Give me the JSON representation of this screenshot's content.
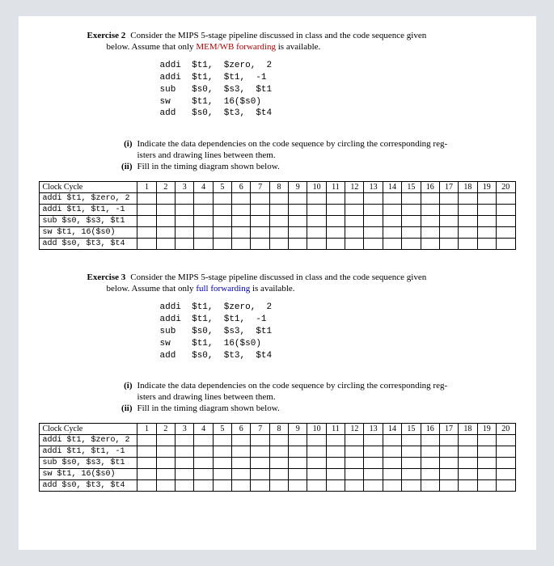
{
  "exercises": [
    {
      "label": "Exercise 2",
      "intro_line1": "Consider the MIPS 5-stage pipeline discussed in class and the code sequence given",
      "intro_line2_a": "below. Assume that only ",
      "intro_hl": "MEM/WB forwarding",
      "intro_line2_b": " is available.",
      "hl_class": "hl-red",
      "code": "addi  $t1,  $zero,  2\naddi  $t1,  $t1,  -1\nsub   $s0,  $s3,  $t1\nsw    $t1,  16($s0)\nadd   $s0,  $t3,  $t4",
      "parts": [
        {
          "marker": "(i)",
          "line1": "Indicate the data dependencies on the code sequence by circling the corresponding reg-",
          "line2": "isters and drawing lines between them."
        },
        {
          "marker": "(ii)",
          "line1": "Fill in the timing diagram shown below.",
          "line2": ""
        }
      ],
      "table": {
        "header": "Clock Cycle",
        "cycles": [
          "1",
          "2",
          "3",
          "4",
          "5",
          "6",
          "7",
          "8",
          "9",
          "10",
          "11",
          "12",
          "13",
          "14",
          "15",
          "16",
          "17",
          "18",
          "19",
          "20"
        ],
        "rows": [
          "addi $t1, $zero, 2",
          "addi $t1, $t1, -1",
          "sub  $s0, $s3, $t1",
          "sw   $t1, 16($s0)",
          "add  $s0, $t3, $t4"
        ]
      }
    },
    {
      "label": "Exercise 3",
      "intro_line1": "Consider the MIPS 5-stage pipeline discussed in class and the code sequence given",
      "intro_line2_a": "below. Assume that only ",
      "intro_hl": "full forwarding",
      "intro_line2_b": " is available.",
      "hl_class": "hl-blue",
      "code": "addi  $t1,  $zero,  2\naddi  $t1,  $t1,  -1\nsub   $s0,  $s3,  $t1\nsw    $t1,  16($s0)\nadd   $s0,  $t3,  $t4",
      "parts": [
        {
          "marker": "(i)",
          "line1": "Indicate the data dependencies on the code sequence by circling the corresponding reg-",
          "line2": "isters and drawing lines between them."
        },
        {
          "marker": "(ii)",
          "line1": "Fill in the timing diagram shown below.",
          "line2": ""
        }
      ],
      "table": {
        "header": "Clock Cycle",
        "cycles": [
          "1",
          "2",
          "3",
          "4",
          "5",
          "6",
          "7",
          "8",
          "9",
          "10",
          "11",
          "12",
          "13",
          "14",
          "15",
          "16",
          "17",
          "18",
          "19",
          "20"
        ],
        "rows": [
          "addi $t1, $zero, 2",
          "addi $t1, $t1, -1",
          "sub  $s0, $s3, $t1",
          "sw   $t1, 16($s0)",
          "add  $s0, $t3, $t4"
        ]
      }
    }
  ]
}
